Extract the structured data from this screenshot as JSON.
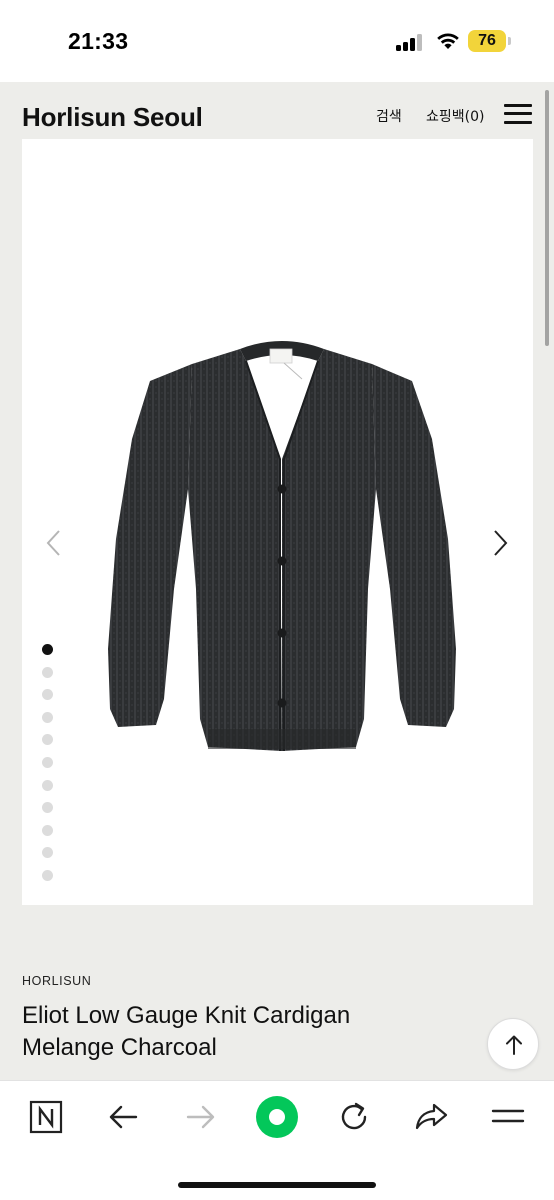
{
  "status_bar": {
    "time": "21:33",
    "battery": "76",
    "battery_color": "#f2d43a"
  },
  "header": {
    "brand": "Horlisun Seoul",
    "search_label": "검색",
    "cart_label": "쇼핑백(0)"
  },
  "gallery": {
    "total_images": 11,
    "current_index": 1,
    "image_subject": "charcoal melange knit cardigan"
  },
  "product": {
    "brand": "HORLISUN",
    "title_line1": "Eliot Low Gauge Knit Cardigan",
    "title_line2": "Melange Charcoal"
  },
  "browser_toolbar": {
    "items": [
      "tab-icon",
      "back-arrow-icon",
      "forward-arrow-icon",
      "home-icon",
      "reload-icon",
      "share-icon",
      "menu-icon"
    ],
    "accent_color": "#03c75a"
  },
  "colors": {
    "page_bg": "#ededea",
    "image_bg": "#ffffff",
    "text": "#111111"
  }
}
